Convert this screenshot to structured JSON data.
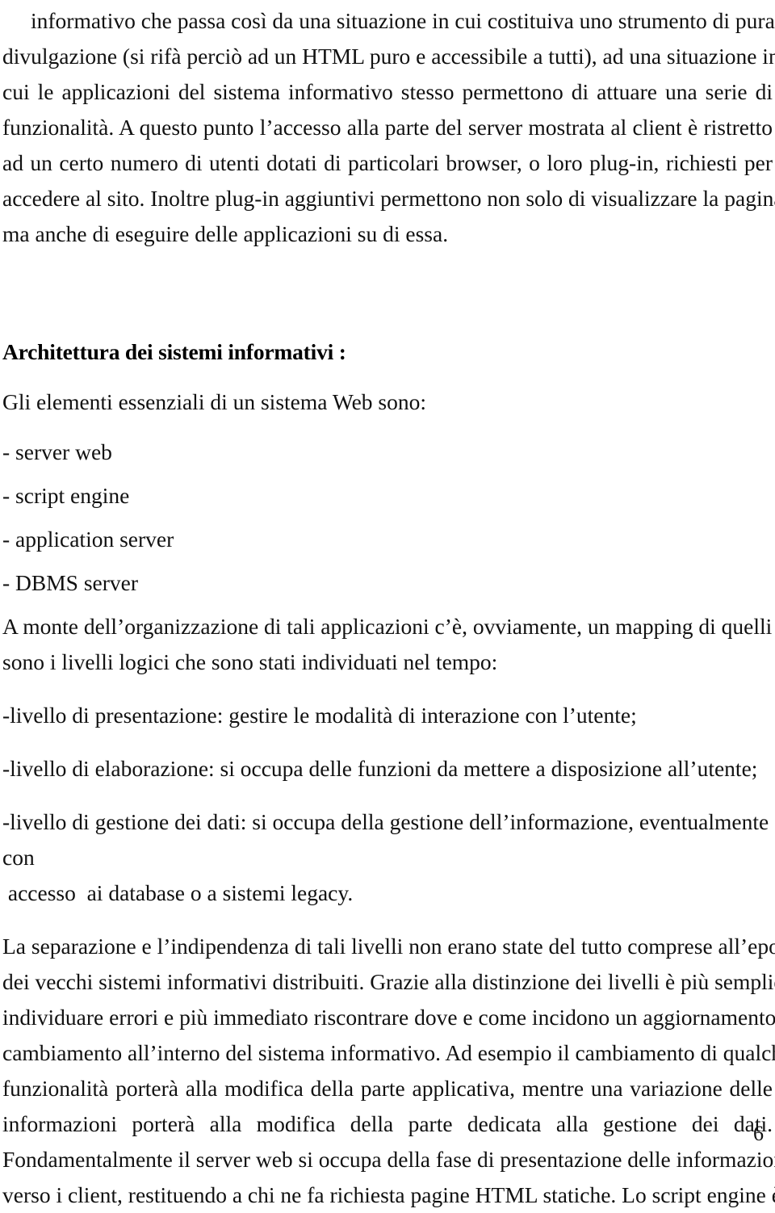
{
  "document": {
    "language": "it",
    "page_number": "6",
    "paragraph_1": {
      "lines": [
        "informativo che passa così da una situazione in cui costituiva uno strumento di pura",
        "divulgazione (si rifà perciò ad un HTML puro e accessibile a tutti), ad una situazione in",
        "cui le applicazioni del sistema informativo stesso permettono di attuare una serie di",
        "funzionalità.  A questo punto l’accesso alla parte del server mostrata al client è ristretto",
        "ad un certo numero di utenti  dotati di particolari browser, o loro plug-in, richiesti per",
        "accedere al sito. Inoltre plug-in aggiuntivi permettono non solo di visualizzare la pagina,",
        "ma anche di eseguire delle applicazioni su di essa."
      ]
    },
    "heading": "Architettura dei sistemi informativi  :",
    "intro_line": "Gli elementi essenziali di un sistema Web sono:",
    "bullets": [
      "- server web",
      "- script engine",
      "- application server",
      "- DBMS server"
    ],
    "paragraph_2": {
      "lines": [
        "A monte dell’organizzazione di tali applicazioni c’è, ovviamente, un mapping di quelli che",
        "sono i livelli logici che sono stati individuati nel tempo:"
      ]
    },
    "levels": [
      "-livello di presentazione: gestire le modalità di interazione con l’utente;",
      "-livello di elaborazione: si occupa delle funzioni da mettere a disposizione all’utente;",
      "-livello di gestione dei dati: si occupa della gestione dell’informazione, eventualmente con",
      " accesso  ai database o a sistemi legacy."
    ],
    "paragraph_3": {
      "lines": [
        "La separazione e l’indipendenza di tali livelli non erano state del tutto comprese all’epoca",
        "dei vecchi sistemi informativi distribuiti. Grazie alla distinzione dei livelli è più semplice",
        "individuare errori e più immediato riscontrare dove e come incidono un aggiornamento o un",
        "cambiamento all’interno del sistema informativo.  Ad esempio il cambiamento di qualche",
        "funzionalità porterà alla modifica della parte applicativa, mentre una variazione delle",
        "informazioni porterà alla modifica della parte dedicata alla gestione dei dati.",
        "Fondamentalmente il server web si occupa della fase di presentazione delle informazioni",
        "verso i client, restituendo a chi ne fa richiesta pagine  HTML statiche. Lo script engine è un"
      ]
    }
  }
}
